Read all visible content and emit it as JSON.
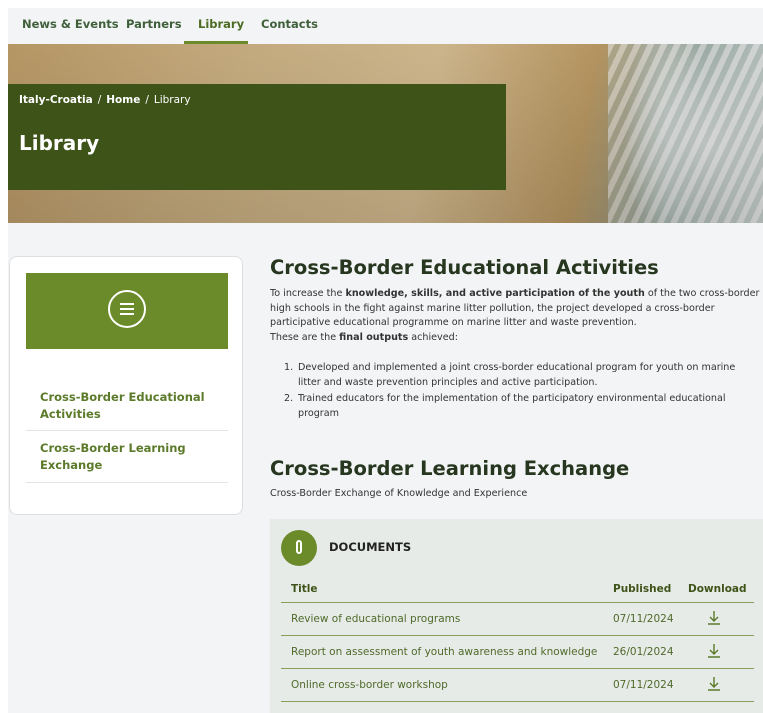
{
  "nav": {
    "items": [
      {
        "label": "News & Events"
      },
      {
        "label": "Partners"
      },
      {
        "label": "Library"
      },
      {
        "label": "Contacts"
      }
    ],
    "active": "Library"
  },
  "hero": {
    "breadcrumb": {
      "root": "Italy-Croatia",
      "sep": "/",
      "home": "Home",
      "current": "Library"
    },
    "title": "Library"
  },
  "sidebar": {
    "menu_icon": "hamburger-icon",
    "items": [
      {
        "label": "Cross-Border Educational Activities"
      },
      {
        "label": "Cross-Border Learning Exchange"
      }
    ]
  },
  "section1": {
    "title": "Cross-Border Educational Activities",
    "intro_pre": "To increase the ",
    "intro_bold": "knowledge, skills, and active participation of the youth",
    "intro_post": " of the two cross-border high schools in the fight against marine litter pollution, the project developed a cross-border participative educational programme on marine litter and waste prevention.",
    "outputs_pre": "These are the ",
    "outputs_bold": "final outputs",
    "outputs_post": " achieved:",
    "list": [
      {
        "num": "1.",
        "text": "Developed and implemented a joint cross-border educational program for youth on marine litter and waste prevention principles and active participation."
      },
      {
        "num": "2.",
        "text": "Trained educators for the implementation of the participatory environmental educational program"
      }
    ]
  },
  "section2": {
    "title": "Cross-Border Learning Exchange",
    "subtitle": "Cross-Border Exchange of Knowledge and Experience"
  },
  "documents": {
    "icon": "paperclip-icon",
    "heading": "DOCUMENTS",
    "columns": {
      "title": "Title",
      "published": "Published",
      "download": "Download"
    },
    "rows": [
      {
        "title": "Review of educational programs",
        "published": "07/11/2024"
      },
      {
        "title": "Report on assessment of youth awareness and knowledge",
        "published": "26/01/2024"
      },
      {
        "title": "Online cross-border workshop",
        "published": "07/11/2024"
      }
    ]
  },
  "colors": {
    "brand_green": "#6b8a2a",
    "dark_green": "#3e5318",
    "page_bg": "#f2f4f5"
  }
}
